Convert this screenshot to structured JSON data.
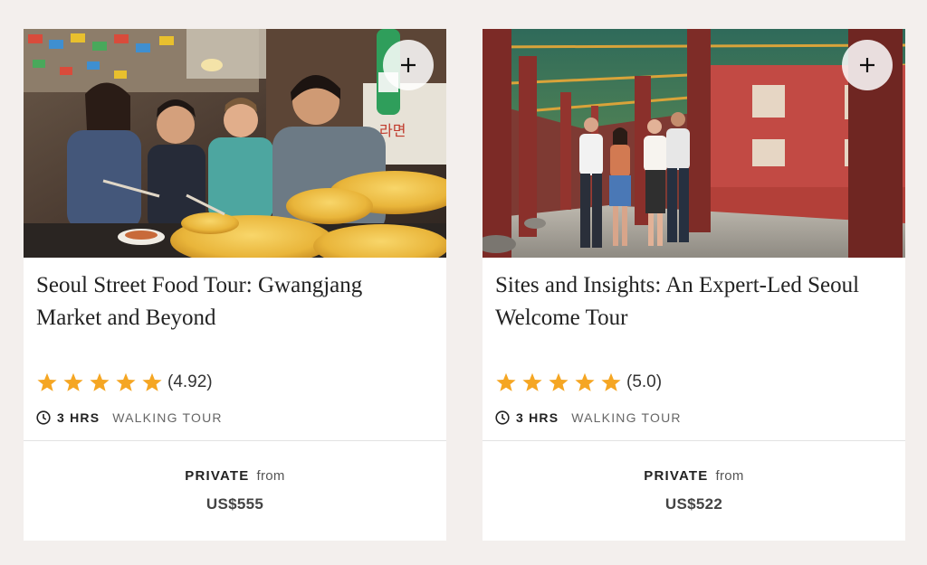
{
  "colors": {
    "page_background": "#f3efed",
    "card_background": "#ffffff",
    "star": "#f5a623",
    "title_text": "#222222"
  },
  "tours": [
    {
      "photo_icon": "street-food-photo",
      "add_button_label": "+",
      "title": "Seoul Street Food Tour: Gwangjang Market and Beyond",
      "rating_stars": 5,
      "rating_display": "(4.92)",
      "duration": "3 HRS",
      "tour_type": "WALKING TOUR",
      "private_label": "PRIVATE",
      "from_label": "from",
      "price": "US$555"
    },
    {
      "photo_icon": "palace-corridor-photo",
      "add_button_label": "+",
      "title": "Sites and Insights: An Expert-Led Seoul Welcome Tour",
      "rating_stars": 5,
      "rating_display": "(5.0)",
      "duration": "3 HRS",
      "tour_type": "WALKING TOUR",
      "private_label": "PRIVATE",
      "from_label": "from",
      "price": "US$522"
    }
  ]
}
